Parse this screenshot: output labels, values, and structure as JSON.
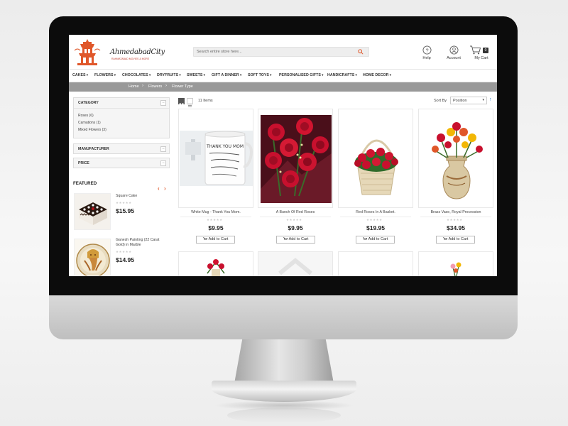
{
  "header": {
    "logo_text": "AhmedabadCity",
    "logo_tagline": "RAHMATABAD MOVIES & MORE",
    "search_placeholder": "Search entire store here...",
    "help_label": "Help",
    "account_label": "Account",
    "cart_label": "My Cart",
    "cart_count": "0"
  },
  "nav": {
    "items": [
      "CAKES",
      "FLOWERS",
      "CHOCOLATES",
      "DRYFRUITS",
      "SWEETS",
      "GIFT A DINNER",
      "SOFT TOYS",
      "PERSONALISED GIFTS",
      "HANDICRAFTS",
      "HOME DECOR"
    ]
  },
  "breadcrumb": [
    "Home",
    "Flowers",
    "Flower Type"
  ],
  "sidebar": {
    "category_title": "CATEGORY",
    "category_options": [
      "Roses (6)",
      "Carnations (1)",
      "Mixed Flowers (3)"
    ],
    "manufacturer_title": "MANUFACTURER",
    "price_title": "PRICE",
    "toggle_symbol": "−",
    "featured_title": "FEATURED",
    "featured_prev": "‹",
    "featured_next": "›",
    "featured": [
      {
        "name": "Square Cake",
        "price": "$15.95",
        "stars": "★★★★★"
      },
      {
        "name": "Ganesh Painting (22 Carat Gold) in Marble",
        "price": "$14.95",
        "stars": "★★★★★"
      }
    ]
  },
  "toolbar": {
    "items_count": "11 Items",
    "sort_label": "Sort By",
    "sort_value": "Position",
    "sort_direction": "↑"
  },
  "products": [
    {
      "name": "White Mug - Thank You Mom.",
      "price": "$9.95",
      "stars": "★★★★★",
      "button": "Add to Cart"
    },
    {
      "name": "A Bunch Of Red Roses",
      "price": "$9.95",
      "stars": "★★★★★",
      "button": "Add to Cart"
    },
    {
      "name": "Red Roses In A Basket.",
      "price": "$19.95",
      "stars": "★★★★★",
      "button": "Add to Cart"
    },
    {
      "name": "Brass Vase, Royal Procession",
      "price": "$34.95",
      "stars": "★★★★★",
      "button": "Add to Cart"
    }
  ],
  "mug_text": "THANK YOU MOM",
  "colors": {
    "accent": "#e0572a",
    "breadcrumb_bg": "#999999",
    "rose_red": "#c8102e",
    "bezel": "#0c0c0c"
  }
}
